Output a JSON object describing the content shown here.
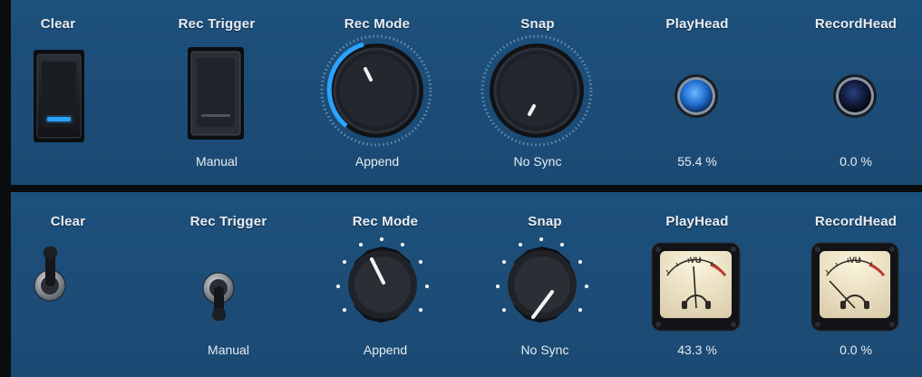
{
  "top": {
    "clear": {
      "title": "Clear",
      "state": "on"
    },
    "rec_trigger": {
      "title": "Rec Trigger",
      "value": "Manual"
    },
    "rec_mode": {
      "title": "Rec Mode",
      "value": "Append"
    },
    "snap": {
      "title": "Snap",
      "value": "No Sync"
    },
    "playhead": {
      "title": "PlayHead",
      "value": "55.4 %"
    },
    "recordhead": {
      "title": "RecordHead",
      "value": "0.0 %"
    }
  },
  "bottom": {
    "clear": {
      "title": "Clear",
      "state": "up"
    },
    "rec_trigger": {
      "title": "Rec Trigger",
      "value": "Manual"
    },
    "rec_mode": {
      "title": "Rec Mode",
      "value": "Append"
    },
    "snap": {
      "title": "Snap",
      "value": "No Sync"
    },
    "playhead": {
      "title": "PlayHead",
      "value": "43.3 %",
      "meter_label": "VU"
    },
    "recordhead": {
      "title": "RecordHead",
      "value": "0.0 %",
      "meter_label": "VU"
    }
  },
  "colors": {
    "panel": "#1c4c76",
    "accent": "#2aa3ff",
    "text": "#e9eef4"
  },
  "icons": [
    "rocker-switch-icon",
    "knob-icon",
    "led-icon",
    "toggle-switch-icon",
    "vu-meter-icon"
  ]
}
